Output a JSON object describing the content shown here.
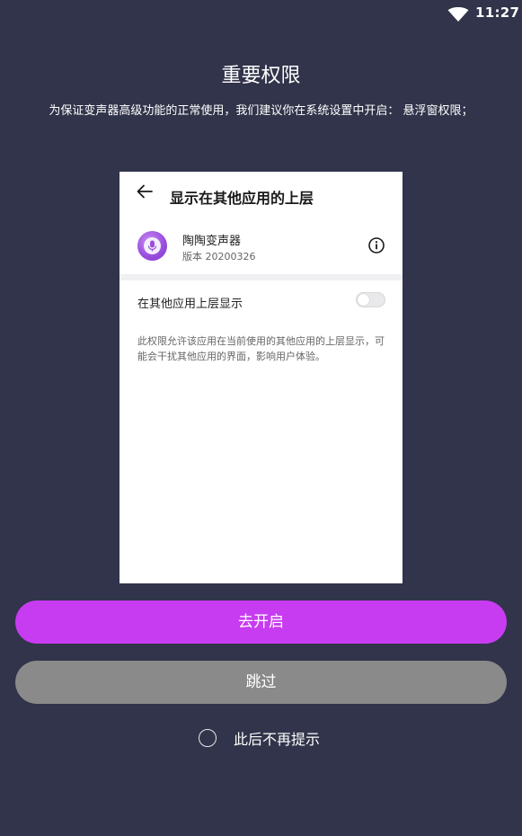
{
  "status_bar": {
    "time": "11:27",
    "wifi_icon": "wifi-icon"
  },
  "dialog": {
    "title": "重要权限",
    "subtitle": "为保证变声器高级功能的正常使用，我们建议你在系统设置中开启： 悬浮窗权限；"
  },
  "preview": {
    "back_icon": "arrow-left-icon",
    "header_title": "显示在其他应用的上层",
    "app_icon": "microphone-icon",
    "app_name": "陶陶变声器",
    "app_version": "版本 20200326",
    "info_icon": "info-icon",
    "toggle_label": "在其他应用上层显示",
    "toggle_state": "off",
    "description": "此权限允许该应用在当前使用的其他应用的上层显示，可能会干扰其他应用的界面，影响用户体验。"
  },
  "actions": {
    "primary_label": "去开启",
    "secondary_label": "跳过"
  },
  "dont_remind": {
    "label": "此后不再提示",
    "checked": false
  },
  "colors": {
    "background": "#31344a",
    "primary_button": "#c73cf0",
    "secondary_button": "#8a8a8a"
  }
}
